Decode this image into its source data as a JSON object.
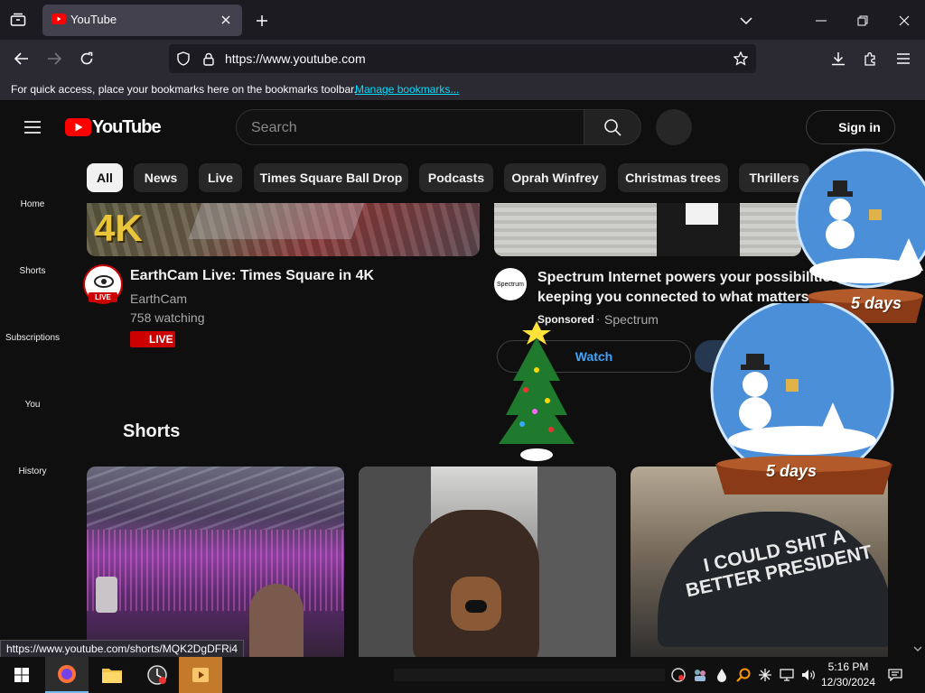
{
  "browser": {
    "tab_title": "YouTube",
    "url": "https://www.youtube.com",
    "bookmarks_hint": "For quick access, place your bookmarks here on the bookmarks toolbar.",
    "bookmarks_link": "Manage bookmarks...",
    "status_url": "https://www.youtube.com/shorts/MQK2DgDFRi4"
  },
  "youtube": {
    "logo_text": "YouTube",
    "search_placeholder": "Search",
    "sign_in": "Sign in",
    "chips": [
      "All",
      "News",
      "Live",
      "Times Square Ball Drop",
      "Podcasts",
      "Oprah Winfrey",
      "Christmas trees",
      "Thrillers"
    ],
    "nav": [
      "Home",
      "Shorts",
      "Subscriptions",
      "You",
      "History"
    ],
    "video1": {
      "thumb_badge": "4K",
      "title": "EarthCam Live: Times Square in 4K",
      "channel": "EarthCam",
      "meta": "758 watching",
      "live_badge": "LIVE",
      "avatar_badge": "LIVE"
    },
    "ad": {
      "title_line1": "Spectrum Internet powers your possibilities,",
      "title_line2": "keeping you connected to what matters m",
      "sponsored": "Sponsored",
      "advertiser": "Spectrum",
      "watch": "Watch",
      "logo_text": "Spectrum"
    },
    "shorts_heading": "Shorts",
    "short3_cap_text": "I COULD SHIT A BETTER PRESIDENT"
  },
  "overlays": {
    "globe_label": "5 days"
  },
  "taskbar": {
    "time": "5:16 PM",
    "date": "12/30/2024"
  },
  "colors": {
    "yt_red": "#ff0000",
    "live_red": "#cc0000",
    "link_blue": "#00ddff",
    "watch_blue": "#3ea6ff"
  }
}
